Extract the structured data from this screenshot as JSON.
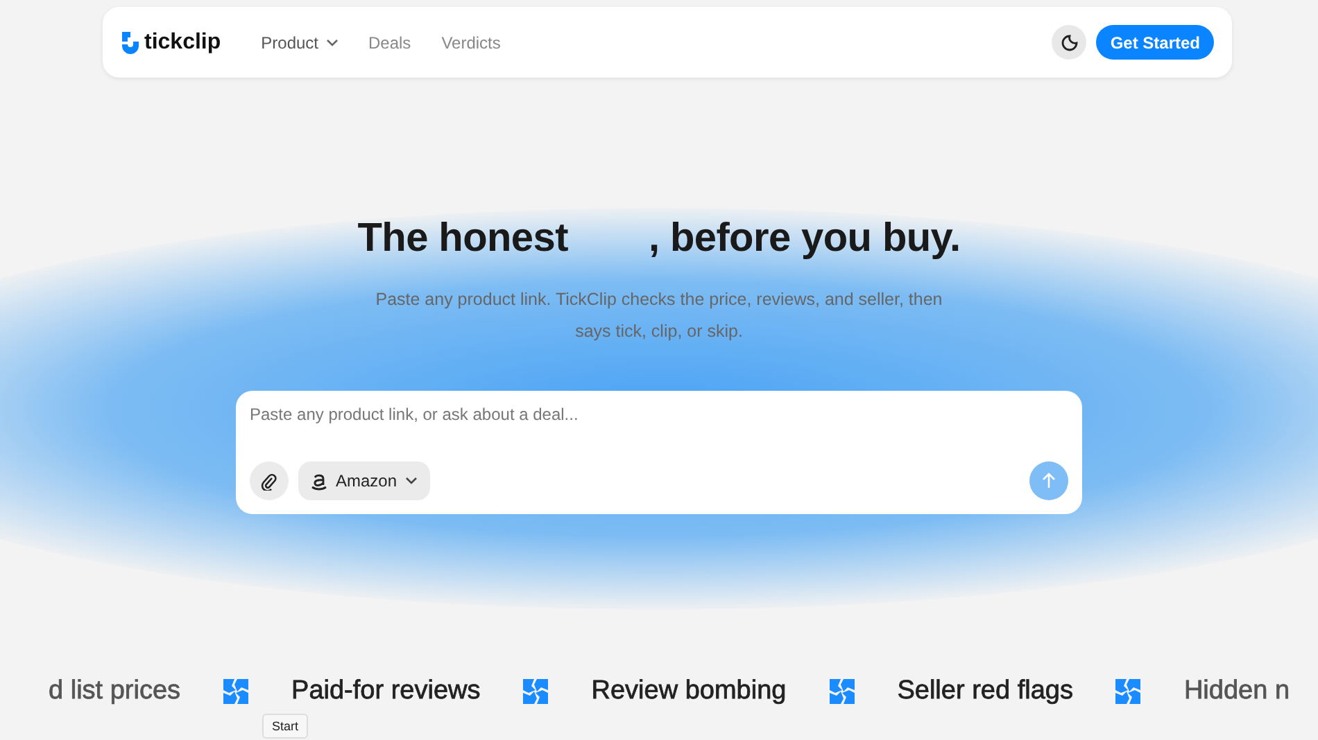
{
  "nav": {
    "logo": "tickclip",
    "links": [
      {
        "label": "Product",
        "dropdown": true
      },
      {
        "label": "Deals",
        "dropdown": false
      },
      {
        "label": "Verdicts",
        "dropdown": false
      }
    ],
    "cta": "Get Started"
  },
  "hero": {
    "title_start": "The honest",
    "title_end": ", before you buy.",
    "subtitle": "Paste any product link. TickClip checks the price, reviews, and seller, then says tick, clip, or skip."
  },
  "prompt": {
    "placeholder": "Paste any product link, or ask about a deal...",
    "store": "Amazon"
  },
  "marquee": [
    "d list prices",
    "Paid-for reviews",
    "Review bombing",
    "Seller red flags",
    "Hidden n"
  ],
  "tooltip": "Start"
}
